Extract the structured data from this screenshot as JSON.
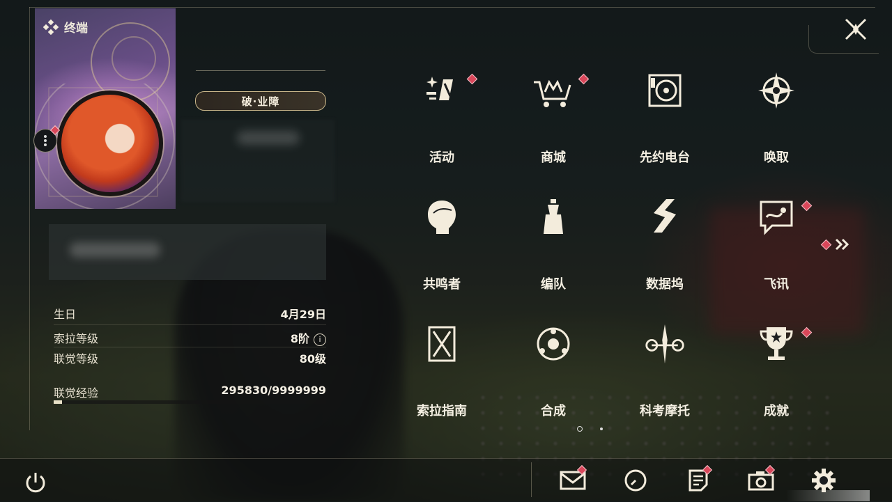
{
  "header": {
    "title": "终端"
  },
  "profile": {
    "badge": "破·业障",
    "stats": [
      {
        "label": "生日",
        "value": "4月29日"
      },
      {
        "label": "索拉等级",
        "value": "8阶"
      },
      {
        "label": "联觉等级",
        "value": "80级"
      },
      {
        "label": "联觉经验",
        "value": "295830/9999999"
      }
    ],
    "exp_progress": 0.03
  },
  "menu": [
    {
      "label": "活动",
      "icon": "sparkle-flag-icon",
      "badge": true
    },
    {
      "label": "商城",
      "icon": "crown-cart-icon",
      "badge": true
    },
    {
      "label": "先约电台",
      "icon": "radio-record-icon",
      "badge": false
    },
    {
      "label": "唤取",
      "icon": "compass-star-icon",
      "badge": false
    },
    {
      "label": "共鸣者",
      "icon": "character-head-icon",
      "badge": false
    },
    {
      "label": "编队",
      "icon": "chess-pieces-icon",
      "badge": false
    },
    {
      "label": "数据坞",
      "icon": "data-dock-icon",
      "badge": false
    },
    {
      "label": "飞讯",
      "icon": "chat-message-icon",
      "badge": true
    },
    {
      "label": "索拉指南",
      "icon": "guide-book-icon",
      "badge": false
    },
    {
      "label": "合成",
      "icon": "synthesis-orb-icon",
      "badge": false
    },
    {
      "label": "科考摩托",
      "icon": "motorcycle-icon",
      "badge": false
    },
    {
      "label": "成就",
      "icon": "trophy-icon",
      "badge": true
    }
  ],
  "bottom": [
    {
      "icon": "mail-icon",
      "badge": true
    },
    {
      "icon": "clock-icon",
      "badge": false
    },
    {
      "icon": "notice-icon",
      "badge": true
    },
    {
      "icon": "camera-icon",
      "badge": true
    },
    {
      "icon": "settings-gear-icon",
      "badge": false
    }
  ],
  "colors": {
    "accent": "#e9e1c8",
    "alert": "#d9475a"
  }
}
